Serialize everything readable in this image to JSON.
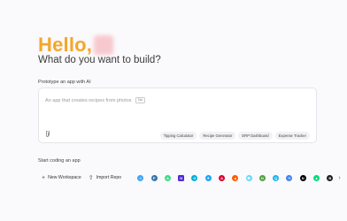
{
  "greeting": {
    "hello": "Hello,",
    "blurred_name": ""
  },
  "subtitle": "What do you want to build?",
  "prototype": {
    "label": "Prototype an app with AI",
    "placeholder": "An app that creates recipes from photos",
    "shortcut": "Tab",
    "chips": [
      "Tipping Calculator",
      "Recipe Generator",
      "ERP Dashboard",
      "Expense Tracker"
    ]
  },
  "coding": {
    "label": "Start coding an app",
    "new_workspace": "New Workspace",
    "import_repo": "Import Repo",
    "templates": [
      {
        "icon": "flutter-icon",
        "color": "#42a5f5",
        "glyph": "≈",
        "shape": "round"
      },
      {
        "icon": "python-icon",
        "color": "#3776ab",
        "glyph": "P",
        "shape": "round"
      },
      {
        "icon": "android-icon",
        "color": "#3ddc84",
        "glyph": "A",
        "shape": "round"
      },
      {
        "icon": "dotnet-icon",
        "color": "#512bd4",
        "glyph": "N",
        "shape": "sq"
      },
      {
        "icon": "go-icon",
        "color": "#00add8",
        "glyph": "G",
        "shape": "round"
      },
      {
        "icon": "react-native-icon",
        "color": "#1fa3ff",
        "glyph": "✦",
        "shape": "round"
      },
      {
        "icon": "angular-icon",
        "color": "#dd0031",
        "glyph": "A",
        "shape": "round"
      },
      {
        "icon": "astro-icon",
        "color": "#ff5d01",
        "glyph": "▲",
        "shape": "round"
      },
      {
        "icon": "react-icon",
        "color": "#61dafb",
        "glyph": "✺",
        "shape": "round"
      },
      {
        "icon": "nodejs-icon",
        "color": "#539e43",
        "glyph": "N",
        "shape": "round"
      },
      {
        "icon": "qwik-icon",
        "color": "#18b6f6",
        "glyph": "Q",
        "shape": "round"
      },
      {
        "icon": "firebase-icon",
        "color": "#4285f4",
        "glyph": "✧",
        "shape": "round"
      },
      {
        "icon": "nextjs-icon",
        "color": "#000000",
        "glyph": "N",
        "shape": "round"
      },
      {
        "icon": "nuxt-icon",
        "color": "#00dc82",
        "glyph": "▲",
        "shape": "round"
      },
      {
        "icon": "bun-icon",
        "color": "#1e1e1e",
        "glyph": "B",
        "shape": "round"
      }
    ]
  }
}
